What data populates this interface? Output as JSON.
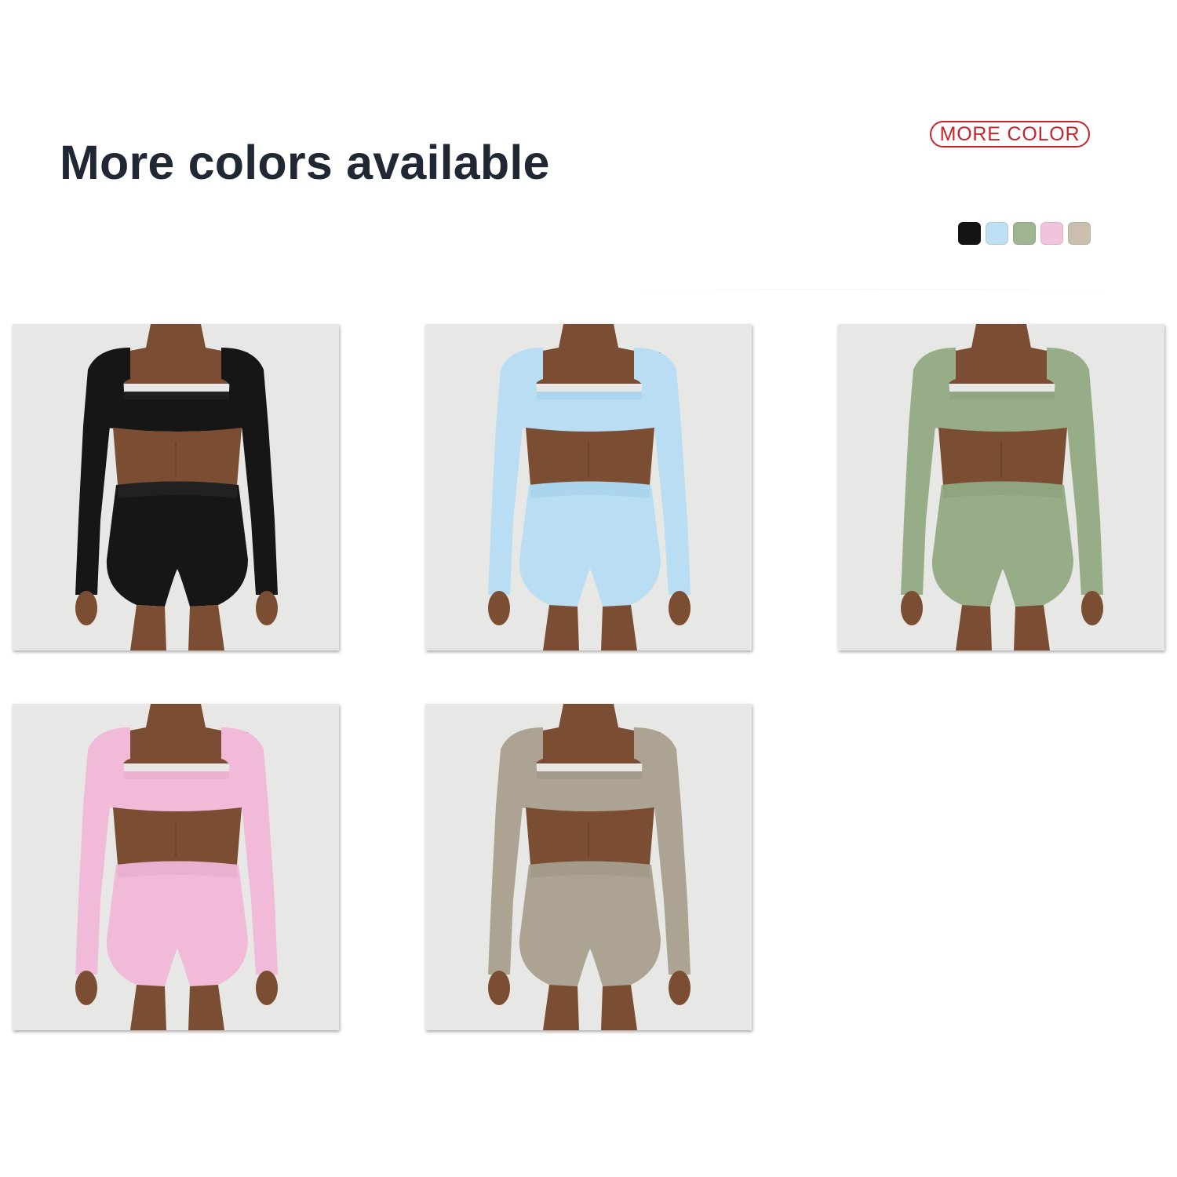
{
  "heading": "More colors available",
  "more_color_label": "MORE COLOR",
  "swatches": [
    {
      "name": "black",
      "color": "#141414"
    },
    {
      "name": "light-blue",
      "color": "#bfe0f4"
    },
    {
      "name": "sage-green",
      "color": "#9fb592"
    },
    {
      "name": "pink",
      "color": "#f2c3dc"
    },
    {
      "name": "khaki",
      "color": "#cabfae"
    }
  ],
  "products": [
    {
      "name": "black-set",
      "color": "#161616",
      "shade": "#2c2c2c"
    },
    {
      "name": "light-blue-set",
      "color": "#b9ddf3",
      "shade": "#9ecbe8"
    },
    {
      "name": "sage-green-set",
      "color": "#97ad87",
      "shade": "#869d77"
    },
    {
      "name": "pink-set",
      "color": "#f0bad8",
      "shade": "#e4a6c8"
    },
    {
      "name": "khaki-set",
      "color": "#aca392",
      "shade": "#9b9281"
    }
  ],
  "skin_color": "#7b4e33"
}
